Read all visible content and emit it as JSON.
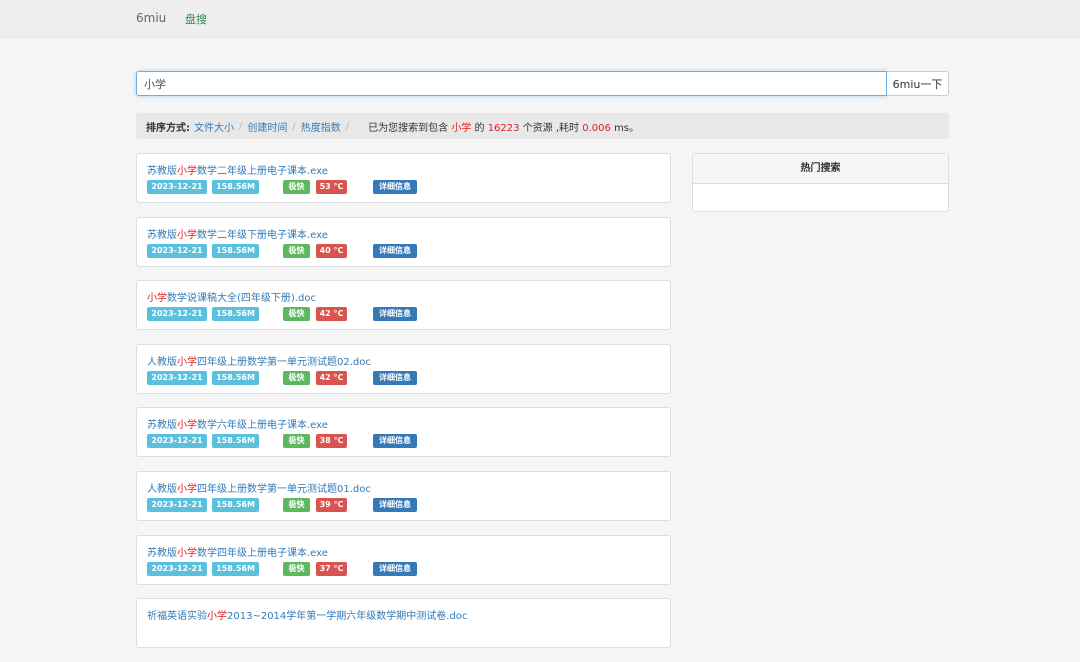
{
  "nav": {
    "brand": "6miu",
    "link": "盘搜"
  },
  "search": {
    "value": "小学",
    "button": "6miu一下"
  },
  "sort": {
    "label": "排序方式:",
    "options": [
      "文件大小",
      "创建时间",
      "热度指数"
    ],
    "summary_prefix": "已为您搜索到包含",
    "keyword": "小学",
    "summary_mid": "的",
    "count": "16223",
    "summary_time": "个资源 ,耗时",
    "time": "0.006",
    "time_unit": "ms。"
  },
  "results": [
    {
      "prefix": "苏教版",
      "kw": "小学",
      "suffix": "数学二年级上册电子课本.exe",
      "date": "2023-12-21",
      "size": "158.56M",
      "speed": "极快",
      "heat": "53 °C",
      "detail": "详细信息"
    },
    {
      "prefix": "苏教版",
      "kw": "小学",
      "suffix": "数学二年级下册电子课本.exe",
      "date": "2023-12-21",
      "size": "158.56M",
      "speed": "极快",
      "heat": "40 °C",
      "detail": "详细信息"
    },
    {
      "prefix": "",
      "kw": "小学",
      "suffix": "数学说课稿大全(四年级下册).doc",
      "date": "2023-12-21",
      "size": "158.56M",
      "speed": "极快",
      "heat": "42 °C",
      "detail": "详细信息"
    },
    {
      "prefix": "人教版",
      "kw": "小学",
      "suffix": "四年级上册数学第一单元测试题02.doc",
      "date": "2023-12-21",
      "size": "158.56M",
      "speed": "极快",
      "heat": "42 °C",
      "detail": "详细信息"
    },
    {
      "prefix": "苏教版",
      "kw": "小学",
      "suffix": "数学六年级上册电子课本.exe",
      "date": "2023-12-21",
      "size": "158.56M",
      "speed": "极快",
      "heat": "38 °C",
      "detail": "详细信息"
    },
    {
      "prefix": "人教版",
      "kw": "小学",
      "suffix": "四年级上册数学第一单元测试题01.doc",
      "date": "2023-12-21",
      "size": "158.56M",
      "speed": "极快",
      "heat": "39 °C",
      "detail": "详细信息"
    },
    {
      "prefix": "苏教版",
      "kw": "小学",
      "suffix": "数学四年级上册电子课本.exe",
      "date": "2023-12-21",
      "size": "158.56M",
      "speed": "极快",
      "heat": "37 °C",
      "detail": "详细信息"
    },
    {
      "prefix": "祈福英语实验",
      "kw": "小学",
      "suffix": "2013~2014学年第一学期六年级数学期中测试卷.doc",
      "date": "",
      "size": "",
      "speed": "",
      "heat": "",
      "detail": ""
    }
  ],
  "sidebar": {
    "hot_title": "热门搜索"
  },
  "colors": {
    "link": "#337ab7",
    "highlight": "#e02020",
    "info": "#5bc0de",
    "success": "#5cb85c",
    "danger": "#d9534f"
  }
}
